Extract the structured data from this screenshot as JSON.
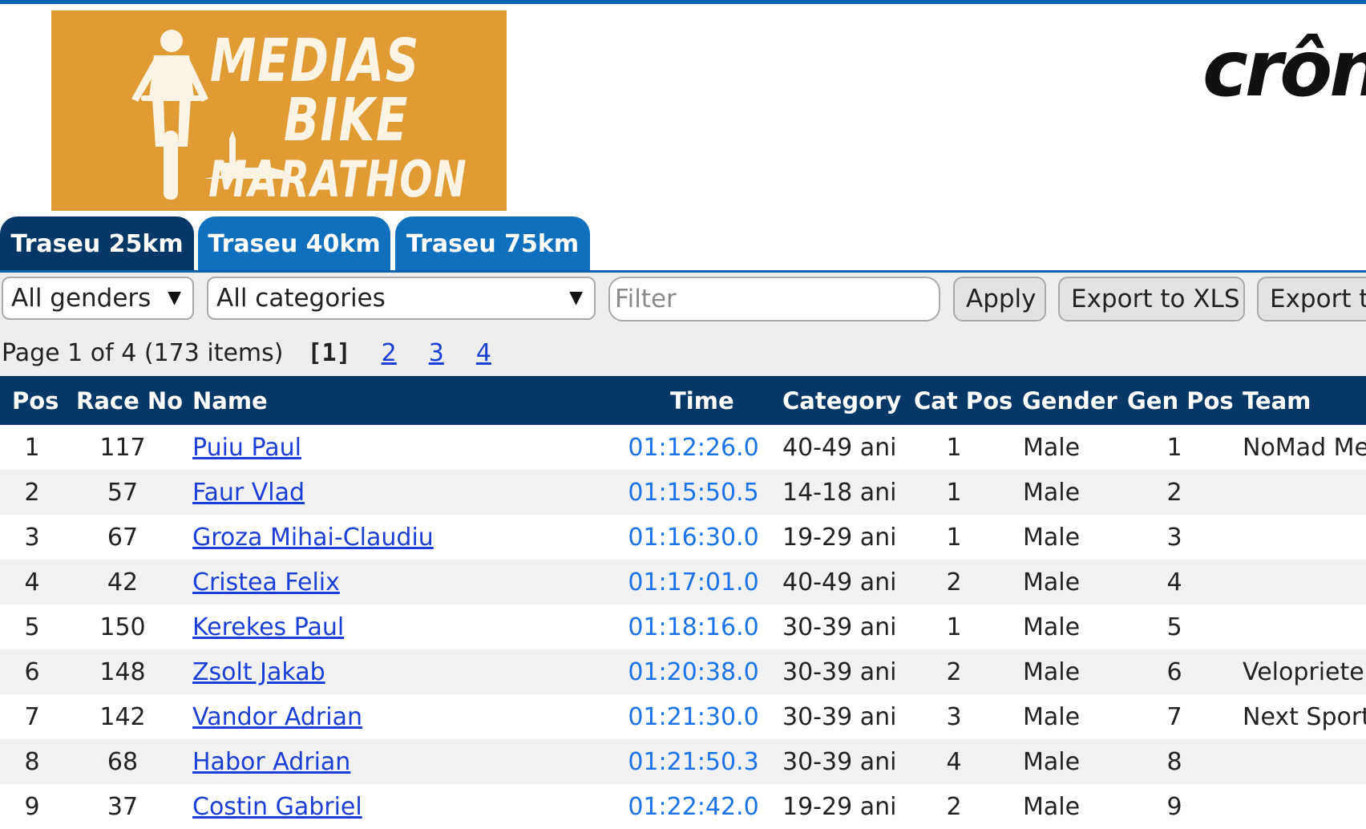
{
  "event": {
    "logo_lines": [
      "MEDIAS",
      "BIKE",
      "MARATHON"
    ],
    "brand_text": "crôn"
  },
  "tabs": [
    {
      "label": "Traseu 25km",
      "active": true
    },
    {
      "label": "Traseu 40km",
      "active": false
    },
    {
      "label": "Traseu 75km",
      "active": false
    }
  ],
  "filters": {
    "gender": "All genders",
    "category": "All categories",
    "filter_placeholder": "Filter",
    "apply_label": "Apply",
    "export_xls_label": "Export to XLS",
    "export_other_label": "Export to"
  },
  "pager": {
    "info": "Page 1 of 4 (173 items)",
    "current": "[1]",
    "pages": [
      "2",
      "3",
      "4"
    ]
  },
  "table": {
    "headers": {
      "pos": "Pos",
      "race_no": "Race No",
      "name": "Name",
      "time": "Time",
      "category": "Category",
      "cat_pos": "Cat Pos",
      "gender": "Gender",
      "gen_pos": "Gen Pos",
      "team": "Team"
    },
    "rows": [
      {
        "pos": "1",
        "race_no": "117",
        "name": "Puiu Paul",
        "time": "01:12:26.0",
        "category": "40-49 ani",
        "cat_pos": "1",
        "gender": "Male",
        "gen_pos": "1",
        "team": "NoMad Mer"
      },
      {
        "pos": "2",
        "race_no": "57",
        "name": "Faur Vlad",
        "time": "01:15:50.5",
        "category": "14-18 ani",
        "cat_pos": "1",
        "gender": "Male",
        "gen_pos": "2",
        "team": ""
      },
      {
        "pos": "3",
        "race_no": "67",
        "name": "Groza Mihai-Claudiu",
        "time": "01:16:30.0",
        "category": "19-29 ani",
        "cat_pos": "1",
        "gender": "Male",
        "gen_pos": "3",
        "team": ""
      },
      {
        "pos": "4",
        "race_no": "42",
        "name": "Cristea Felix",
        "time": "01:17:01.0",
        "category": "40-49 ani",
        "cat_pos": "2",
        "gender": "Male",
        "gen_pos": "4",
        "team": ""
      },
      {
        "pos": "5",
        "race_no": "150",
        "name": "Kerekes Paul",
        "time": "01:18:16.0",
        "category": "30-39 ani",
        "cat_pos": "1",
        "gender": "Male",
        "gen_pos": "5",
        "team": ""
      },
      {
        "pos": "6",
        "race_no": "148",
        "name": "Zsolt Jakab",
        "time": "01:20:38.0",
        "category": "30-39 ani",
        "cat_pos": "2",
        "gender": "Male",
        "gen_pos": "6",
        "team": "Veloprieten"
      },
      {
        "pos": "7",
        "race_no": "142",
        "name": "Vandor Adrian",
        "time": "01:21:30.0",
        "category": "30-39 ani",
        "cat_pos": "3",
        "gender": "Male",
        "gen_pos": "7",
        "team": "Next Sports"
      },
      {
        "pos": "8",
        "race_no": "68",
        "name": "Habor Adrian",
        "time": "01:21:50.3",
        "category": "30-39 ani",
        "cat_pos": "4",
        "gender": "Male",
        "gen_pos": "8",
        "team": ""
      },
      {
        "pos": "9",
        "race_no": "37",
        "name": "Costin Gabriel",
        "time": "01:22:42.0",
        "category": "19-29 ani",
        "cat_pos": "2",
        "gender": "Male",
        "gen_pos": "9",
        "team": ""
      }
    ]
  }
}
